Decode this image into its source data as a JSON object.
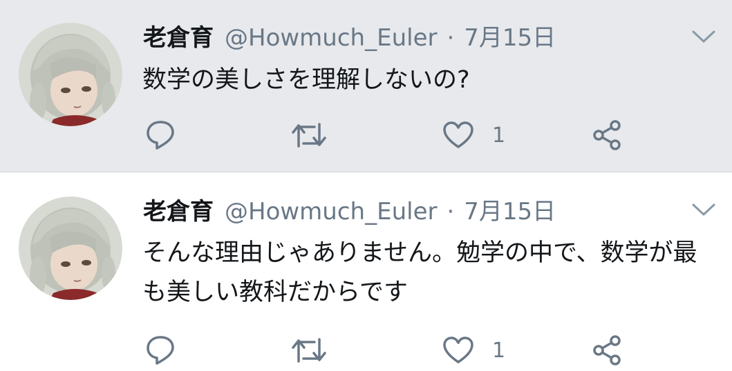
{
  "tweets": [
    {
      "author_name": "老倉育",
      "handle": "@Howmuch_Euler",
      "separator": "·",
      "date": "7月15日",
      "text": "数学の美しさを理解しないの?",
      "like_count": "1",
      "icons": {
        "reply": "reply-icon",
        "retweet": "retweet-icon",
        "like": "heart-icon",
        "share": "share-icon",
        "menu": "chevron-down-icon"
      }
    },
    {
      "author_name": "老倉育",
      "handle": "@Howmuch_Euler",
      "separator": "·",
      "date": "7月15日",
      "text": "そんな理由じゃありません。勉学の中で、数学が最も美しい教科だからです",
      "like_count": "1",
      "icons": {
        "reply": "reply-icon",
        "retweet": "retweet-icon",
        "like": "heart-icon",
        "share": "share-icon",
        "menu": "chevron-down-icon"
      }
    }
  ],
  "colors": {
    "selected_background": "#e7e9ec",
    "text": "#14171a",
    "secondary": "#697786"
  }
}
